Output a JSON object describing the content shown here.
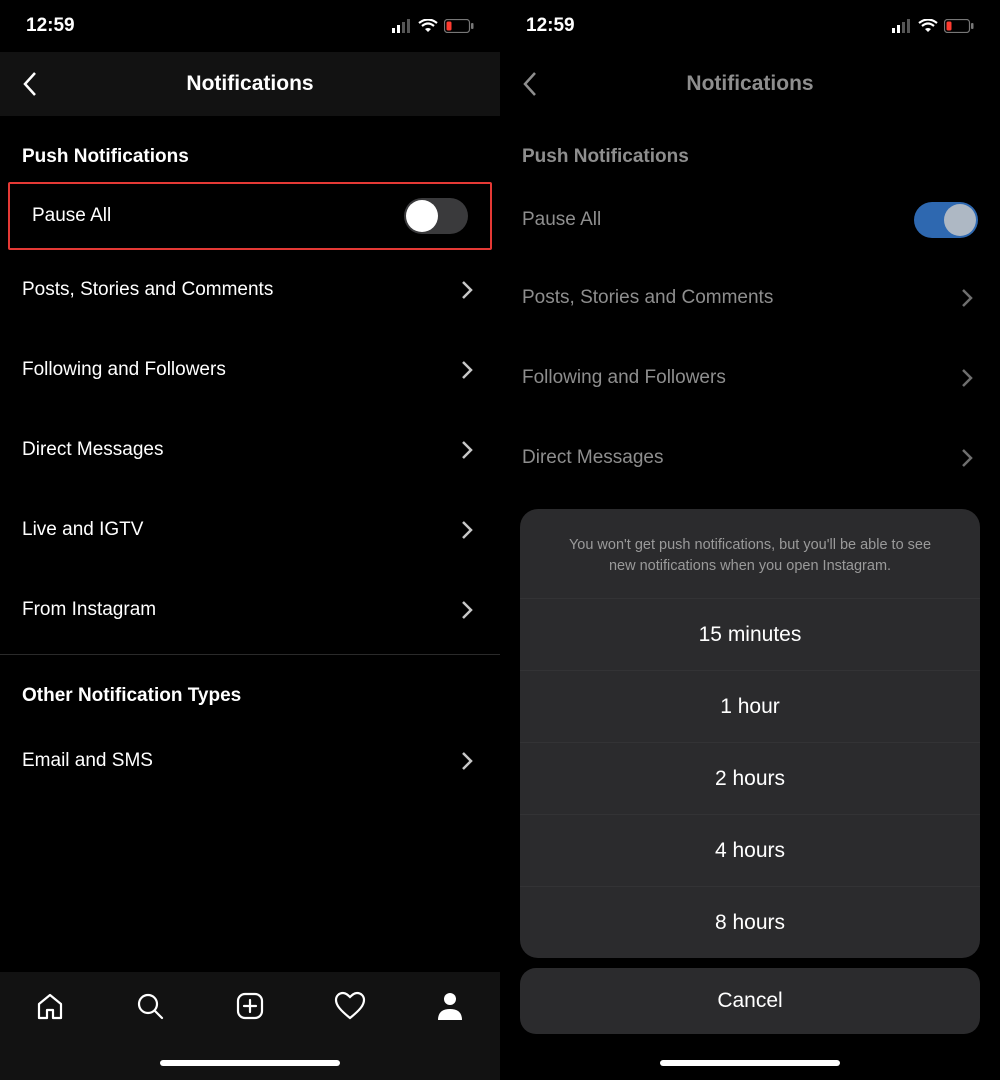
{
  "statusBar": {
    "time": "12:59"
  },
  "left": {
    "navTitle": "Notifications",
    "sectionHeader1": "Push Notifications",
    "pauseAll": "Pause All",
    "rows": [
      "Posts, Stories and Comments",
      "Following and Followers",
      "Direct Messages",
      "Live and IGTV",
      "From Instagram"
    ],
    "sectionHeader2": "Other Notification Types",
    "emailSms": "Email and SMS"
  },
  "right": {
    "navTitle": "Notifications",
    "sectionHeader1": "Push Notifications",
    "pauseAll": "Pause All",
    "rows": [
      "Posts, Stories and Comments",
      "Following and Followers",
      "Direct Messages"
    ],
    "sheet": {
      "message": "You won't get push notifications, but you'll be able to see new notifications when you open Instagram.",
      "options": [
        "15 minutes",
        "1 hour",
        "2 hours",
        "4 hours",
        "8 hours"
      ],
      "cancel": "Cancel"
    }
  }
}
